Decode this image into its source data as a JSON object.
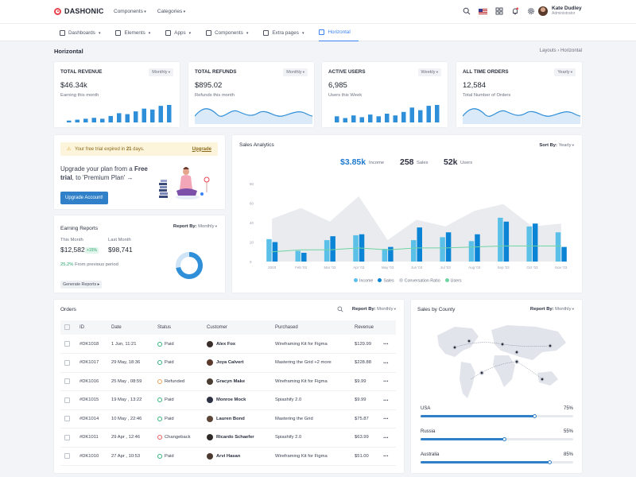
{
  "brand": {
    "name": "DASHONIC"
  },
  "top_menu": [
    "Components",
    "Categories"
  ],
  "user": {
    "name": "Kate Dudley",
    "role": "Administrator"
  },
  "nav": [
    {
      "label": "Dashboards",
      "active": false
    },
    {
      "label": "Elements",
      "active": false
    },
    {
      "label": "Apps",
      "active": false
    },
    {
      "label": "Components",
      "active": false
    },
    {
      "label": "Extra pages",
      "active": false
    },
    {
      "label": "Horizontal",
      "active": true
    }
  ],
  "page": {
    "title": "Horizontal",
    "breadcrumb": "Layouts  ›  Horizontal"
  },
  "stats": [
    {
      "title": "TOTAL REVENUE",
      "period": "Monthly",
      "value": "$46.34k",
      "sub": "Earning this month",
      "chart": "bars",
      "bars": [
        2,
        3,
        4,
        5,
        4,
        7,
        10,
        9,
        12,
        15,
        14,
        18,
        19
      ]
    },
    {
      "title": "TOTAL REFUNDS",
      "period": "Monthly",
      "value": "$895.02",
      "sub": "Refunds this month",
      "chart": "wave"
    },
    {
      "title": "ACTIVE USERS",
      "period": "Weekly",
      "value": "6,985",
      "sub": "Users this Week",
      "chart": "bars",
      "bars": [
        7,
        5,
        8,
        6,
        9,
        7,
        10,
        8,
        12,
        17,
        14,
        19,
        20
      ]
    },
    {
      "title": "ALL TIME ORDERS",
      "period": "Yearly",
      "value": "12,584",
      "sub": "Total Number of Orders",
      "chart": "wave"
    }
  ],
  "trial": {
    "text_before": "Your free trial expired in ",
    "days": "21",
    "text_after": " days.",
    "link": "Upgrade"
  },
  "upgrade": {
    "line_pre": "Upgrade your plan from a ",
    "free": "Free trial",
    "line_post": ", to 'Premium Plan' →",
    "button": "Upgrade Account!"
  },
  "earning": {
    "title": "Earning Reports",
    "report_by": "Report By:",
    "period": "Monthly",
    "this_month_label": "This Month",
    "this_month_value": "$12,582",
    "this_month_badge": "+15%",
    "last_month_label": "Last Month",
    "last_month_value": "$98,741",
    "growth": "25.2%",
    "growth_text": "From previous period",
    "button": "Generate Reports",
    "donut_fraction": 0.72
  },
  "sales": {
    "title": "Sales Analytics",
    "sort_by": "Sort By:",
    "period": "Yearly",
    "income_value": "$3.85k",
    "income_label": "Income",
    "sales_value": "258",
    "sales_label": "Sales",
    "users_value": "52k",
    "users_label": "Users"
  },
  "chart_data": {
    "type": "bar",
    "ylabel": "Sales Analytics",
    "ylim": [
      0,
      80
    ],
    "yticks": [
      "0",
      "20",
      "40",
      "60",
      "80"
    ],
    "categories": [
      "2003",
      "Feb '03",
      "Mar '03",
      "Apr '03",
      "May '03",
      "Jun '03",
      "Jul '03",
      "Aug '03",
      "Sep '03",
      "Oct '03",
      "Nov '03"
    ],
    "series": [
      {
        "name": "Income",
        "type": "bar",
        "color": "#5bc0e8",
        "values": [
          23,
          11,
          22,
          27,
          13,
          22,
          25,
          21,
          45,
          36,
          30
        ]
      },
      {
        "name": "Sales",
        "type": "bar",
        "color": "#0b84d6",
        "values": [
          20,
          9,
          26,
          28,
          15,
          35,
          30,
          28,
          41,
          39,
          15
        ]
      },
      {
        "name": "Conversation Ratio",
        "type": "area",
        "color": "#e9ebef",
        "values": [
          44,
          55,
          41,
          67,
          22,
          43,
          36,
          52,
          59,
          36,
          39
        ]
      },
      {
        "name": "Users",
        "type": "line",
        "color": "#6fd3a4",
        "values": [
          10,
          12,
          12,
          14,
          12,
          14,
          14,
          15,
          16,
          16,
          16
        ]
      }
    ],
    "legend": "bottom"
  },
  "orders": {
    "title": "Orders",
    "report_by": "Report By:",
    "period": "Monthly",
    "columns": [
      "ID",
      "Date",
      "Status",
      "Customer",
      "Purchased",
      "Revenue"
    ],
    "rows": [
      {
        "id": "#DK1018",
        "date": "1 Jun, 11:21",
        "status": "Paid",
        "status_color": "#34b27b",
        "customer": "Alex Fox",
        "purchased": "Wireframing Kit for Figma",
        "revenue": "$129.99"
      },
      {
        "id": "#DK1017",
        "date": "29 May, 18:36",
        "status": "Paid",
        "status_color": "#34b27b",
        "customer": "Joya Calvert",
        "purchased": "Mastering the Grid +2 more",
        "revenue": "$228.88"
      },
      {
        "id": "#DK1016",
        "date": "25 May , 08:59",
        "status": "Refunded",
        "status_color": "#f0a35a",
        "customer": "Gracyn Make",
        "purchased": "Wireframing Kit for Figma",
        "revenue": "$9.99"
      },
      {
        "id": "#DK1015",
        "date": "19 May , 13:22",
        "status": "Paid",
        "status_color": "#34b27b",
        "customer": "Monroe Mock",
        "purchased": "Spiashify 2.0",
        "revenue": "$9.99"
      },
      {
        "id": "#DK1014",
        "date": "10 May , 22:46",
        "status": "Paid",
        "status_color": "#34b27b",
        "customer": "Lauren Bond",
        "purchased": "Mastering the Grid",
        "revenue": "$75.87"
      },
      {
        "id": "#DK1011",
        "date": "29 Apr , 12:46",
        "status": "Changeback",
        "status_color": "#e85a5a",
        "customer": "Ricardo Schaefer",
        "purchased": "Spiashify 2.0",
        "revenue": "$63.99"
      },
      {
        "id": "#DK1010",
        "date": "27 Apr , 10:53",
        "status": "Paid",
        "status_color": "#34b27b",
        "customer": "Arvi Hasan",
        "purchased": "Wireframing Kit for Figma",
        "revenue": "$51.00"
      }
    ]
  },
  "county": {
    "title": "Sales by County",
    "report_by": "Report By:",
    "period": "Monthly",
    "items": [
      {
        "label": "USA",
        "percent": "75%",
        "value": 75
      },
      {
        "label": "Russia",
        "percent": "55%",
        "value": 55
      },
      {
        "label": "Australia",
        "percent": "85%",
        "value": 85
      }
    ]
  }
}
